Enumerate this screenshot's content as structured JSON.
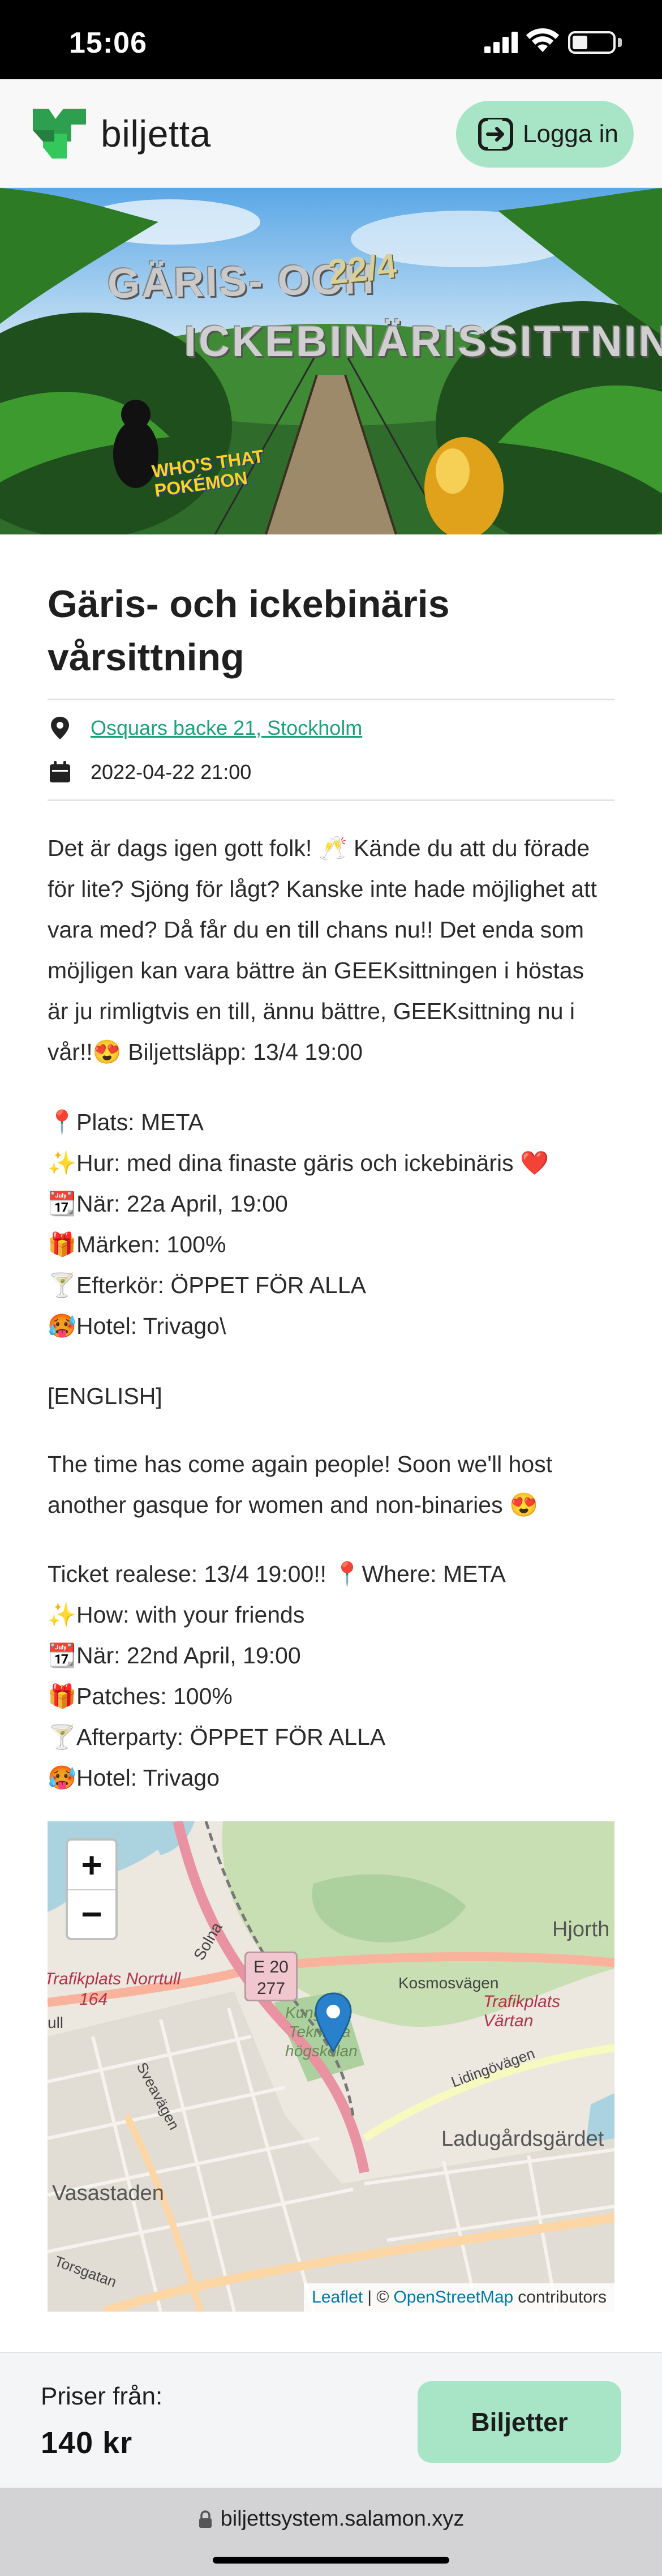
{
  "status_bar": {
    "time": "15:06",
    "icons": [
      "signal-icon",
      "wifi-icon",
      "battery-icon"
    ]
  },
  "header": {
    "logo_text": "biljetta",
    "login_label": "Logga in",
    "accent_color": "#a8e4c6",
    "logo_colors": [
      "#2e9e4f",
      "#34c759"
    ]
  },
  "banner": {
    "title_line1": "GÄRIS- OCH",
    "date": "22/4",
    "title_line2": "ICKEBINÄRISSITTNING",
    "poke_text_1": "WHO'S THAT",
    "poke_text_2": "POKÉMON"
  },
  "event": {
    "title": "Gäris- och ickebinäris vårsittning",
    "location": "Osquars backe 21, Stockholm",
    "datetime": "2022-04-22 21:00",
    "link_color": "#1aa37a"
  },
  "description": {
    "intro_lines": [
      "Det är dags igen gott folk! 🥂 Kände du att du förade",
      "för lite? Sjöng för lågt? Kanske inte hade möjlighet att",
      "vara med? Då får du en till chans nu!! Det enda som",
      "möjligen kan vara bättre än GEEKsittningen i höstas",
      "är ju rimligtvis en till, ännu bättre, GEEKsittning nu i",
      "vår!!😍 Biljettsläpp: 13/4 19:00"
    ],
    "details_sv": [
      "📍Plats: META",
      "✨Hur: med dina finaste gäris och ickebinäris ❤️",
      "📆När: 22a April, 19:00",
      "🎁Märken: 100%",
      "🍸Efterkör: ÖPPET FÖR ALLA",
      "🥵Hotel: Trivago\\"
    ],
    "english_header": "[ENGLISH]",
    "english_intro_lines": [
      "The time has come again people! Soon we'll host",
      "another gasque for women and non-binaries 😍"
    ],
    "details_en": [
      "Ticket realese: 13/4 19:00!! 📍Where: META",
      "✨How: with your friends",
      "📆När: 22nd April, 19:00",
      "🎁Patches: 100%",
      "🍸Afterparty: ÖPPET FÖR ALLA",
      "🥵Hotel: Trivago"
    ]
  },
  "map": {
    "zoom_in": "+",
    "zoom_out": "−",
    "labels": {
      "hjorth": "Hjorth",
      "trafikplats_norrtull": "Trafikplats Norrtull",
      "route_164": "164",
      "ull": "ull",
      "solna": "Solna",
      "route_e20": "E 20",
      "route_277": "277",
      "kungliga": "Kungliga",
      "tekniska": "Tekniska",
      "hogskolan": "högskolan",
      "kosmosvagen": "Kosmosvägen",
      "trafikplats_vartan": "Trafikplats Värtan",
      "lidingovagen": "Lidingövägen",
      "sveavagen": "Sveavägen",
      "ladugardsgardet": "Ladugårdsgärdet",
      "vasastaden": "Vasastaden",
      "torsgatan": "Torsgatan"
    },
    "attribution": {
      "leaflet": "Leaflet",
      "separator": "| ©",
      "osm": "OpenStreetMap",
      "contributors": "contributors"
    },
    "marker_color": "#2a81cb"
  },
  "footer": {
    "price_label": "Priser från:",
    "price_value": "140 kr",
    "tickets_label": "Biljetter"
  },
  "browser": {
    "url": "biljettsystem.salamon.xyz"
  }
}
